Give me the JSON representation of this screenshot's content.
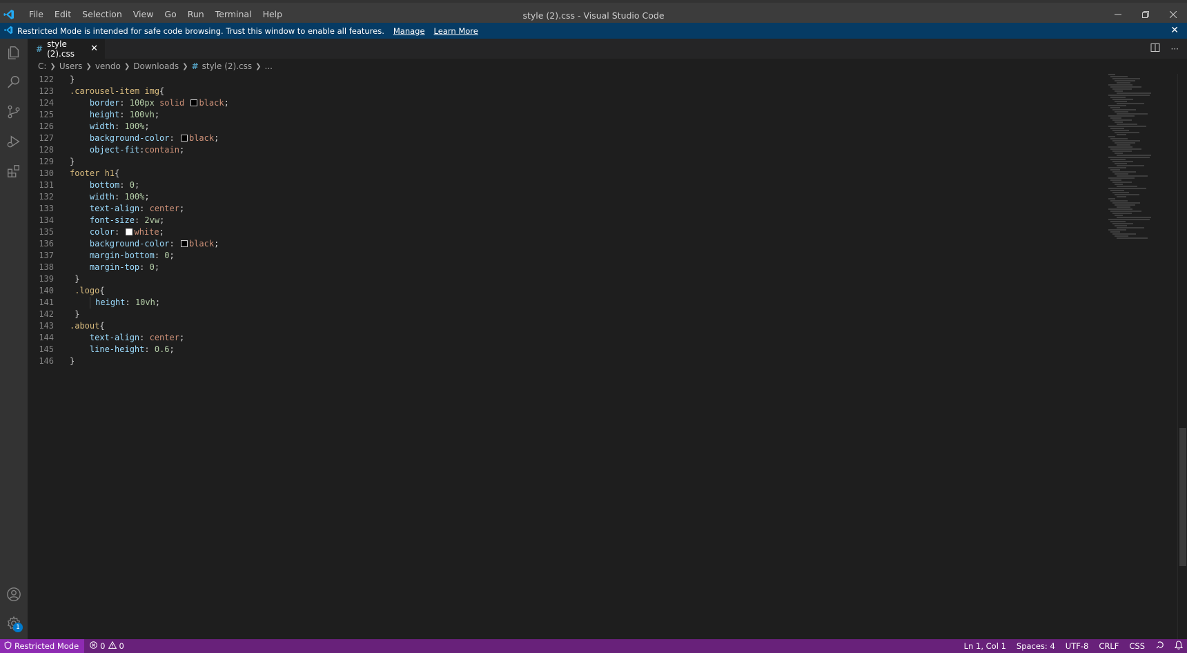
{
  "window": {
    "title": "style (2).css - Visual Studio Code",
    "menu": [
      "File",
      "Edit",
      "Selection",
      "View",
      "Go",
      "Run",
      "Terminal",
      "Help"
    ]
  },
  "banner": {
    "text": "Restricted Mode is intended for safe code browsing. Trust this window to enable all features.",
    "manage": "Manage",
    "learn_more": "Learn More"
  },
  "tab": {
    "label": "style (2).css"
  },
  "breadcrumbs": {
    "items": [
      "C:",
      "Users",
      "vendo",
      "Downloads"
    ],
    "file": "style (2).css",
    "more": "..."
  },
  "editor": {
    "line_numbers": [
      "122",
      "123",
      "124",
      "125",
      "126",
      "127",
      "128",
      "129",
      "130",
      "131",
      "132",
      "133",
      "134",
      "135",
      "136",
      "137",
      "138",
      "139",
      "140",
      "141",
      "142",
      "143",
      "144",
      "145",
      "146"
    ]
  },
  "colors": {
    "accent": "#007acc",
    "statusbar": "#68217a",
    "banner": "#063b64"
  },
  "statusbar": {
    "restricted": "Restricted Mode",
    "errors": "0",
    "warnings": "0",
    "position": "Ln 1, Col 1",
    "spaces": "Spaces: 4",
    "encoding": "UTF-8",
    "eol": "CRLF",
    "language": "CSS"
  },
  "activity": {
    "settings_badge": "1"
  }
}
